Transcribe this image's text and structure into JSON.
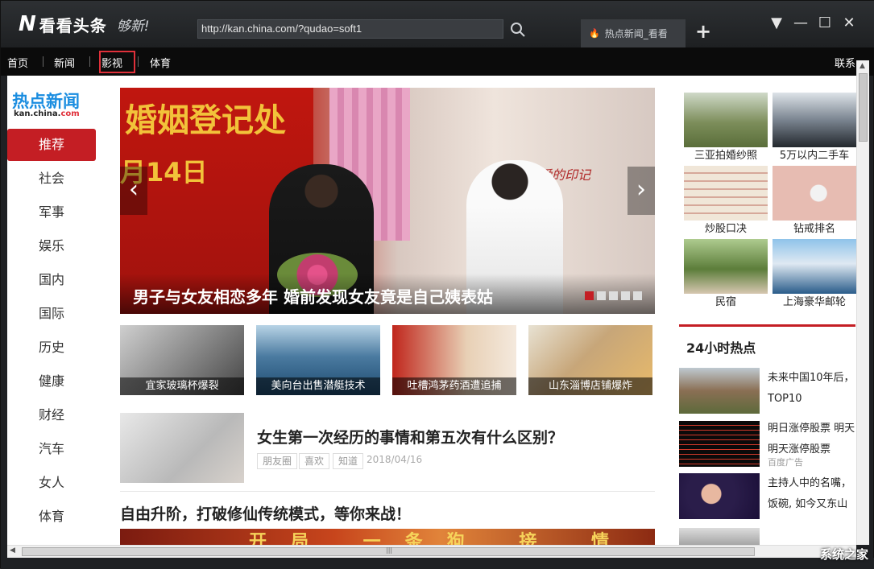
{
  "app": {
    "brand_letter": "N",
    "name": "看看头条",
    "slogan": "够新!"
  },
  "address_bar": {
    "url": "http://kan.china.com/?qudao=soft1"
  },
  "tab": {
    "label": "热点新闻_看看"
  },
  "menubar": {
    "items": [
      "首页",
      "新闻",
      "影视",
      "体育"
    ],
    "right_label": "联系",
    "highlighted": "影视"
  },
  "site": {
    "title": "热点新闻",
    "domain_prefix": "kan.china.",
    "domain_suffix": "com"
  },
  "sidebar": {
    "items": [
      "推荐",
      "社会",
      "军事",
      "娱乐",
      "国内",
      "国际",
      "历史",
      "健康",
      "财经",
      "汽车",
      "女人",
      "体育"
    ],
    "active": "推荐"
  },
  "hero": {
    "sign_text": "婚姻登记处",
    "sign_date": "月14日",
    "deco_text": "爱的印记",
    "caption": "男子与女友相恋多年 婚前发现女友竟是自己姨表姑",
    "prev": "‹",
    "next": "›",
    "slides": 5,
    "active_slide": 1
  },
  "thumbs": [
    {
      "caption": "宜家玻璃杯爆裂"
    },
    {
      "caption": "美向台出售潜艇技术"
    },
    {
      "caption": "吐槽鸿茅药酒遭追捕"
    },
    {
      "caption": "山东淄博店铺爆炸"
    }
  ],
  "article": {
    "title": "女生第一次经历的事情和第五次有什么区别？",
    "tags": [
      "朋友圈",
      "喜欢",
      "知道"
    ],
    "date": "2018/04/16"
  },
  "article2": {
    "title": "自由升阶，打破修仙传统模式，等你来战！",
    "banner_text": "开局 一条狗 接 情 集 令"
  },
  "right_grid": [
    {
      "label": "三亚拍婚纱照"
    },
    {
      "label": "5万以内二手车"
    },
    {
      "label": "炒股口决"
    },
    {
      "label": "钻戒排名"
    },
    {
      "label": "民宿"
    },
    {
      "label": "上海豪华邮轮"
    }
  ],
  "hot": {
    "title": "24小时热点",
    "items": [
      {
        "line1": "未来中国10年后，",
        "line2": "TOP10",
        "ad": ""
      },
      {
        "line1": "明日涨停股票 明天",
        "line2": "明天涨停股票",
        "ad": "百度广告"
      },
      {
        "line1": "主持人中的名嘴，",
        "line2": "饭碗, 如今又东山",
        "ad": ""
      }
    ]
  },
  "watermark": "系统之家",
  "colors": {
    "accent": "#c41e24",
    "brand_blue": "#1a8de0",
    "chrome": "#1f2124"
  }
}
